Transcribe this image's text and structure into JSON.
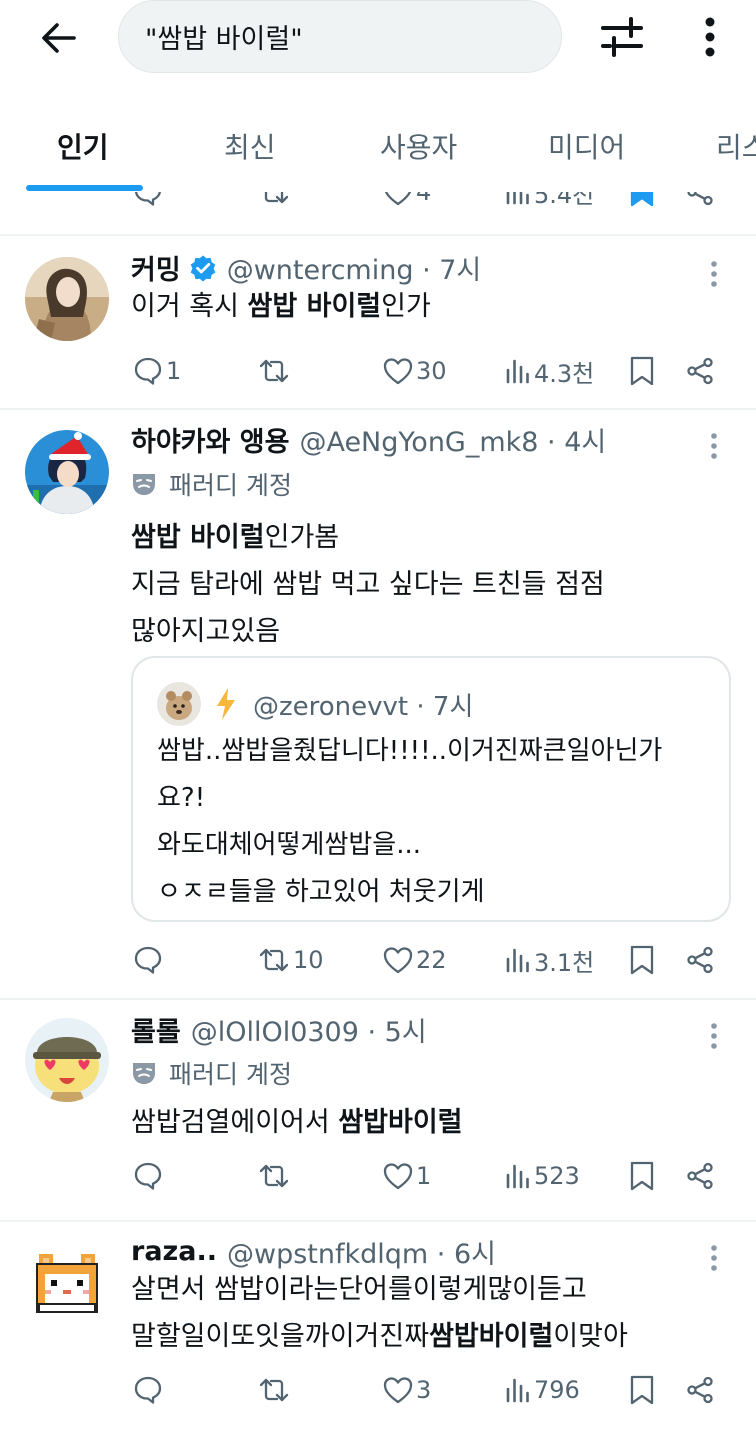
{
  "search": {
    "query": "\"쌈밥 바이럴\""
  },
  "tabs": [
    {
      "label": "인기",
      "active": true
    },
    {
      "label": "최신"
    },
    {
      "label": "사용자"
    },
    {
      "label": "미디어"
    },
    {
      "label": "리스"
    }
  ],
  "top_partial": {
    "likes": "4",
    "views": "5.4천",
    "bookmarked": true
  },
  "tweets": [
    {
      "name": "커밍",
      "verified": true,
      "handle": "@wntercming · 7시",
      "line1_bold": "쌈밥 바이럴",
      "line1_pre": "이거 혹시 ",
      "line1_post": "인가",
      "replies": "1",
      "retweets": "",
      "likes": "30",
      "views": "4.3천"
    },
    {
      "name": "하야카와 앵용",
      "handle": "@AeNgYonG_mk8 · 4시",
      "parody": "패러디 계정",
      "line1_bold": "쌈밥 바이럴",
      "line1_post": "인가봄",
      "line2": "지금 탐라에 쌈밥 먹고 싶다는 트친들 점점",
      "line3": "많아지고있음",
      "quote": {
        "handle": "@zeronevvt · 7시",
        "lines": [
          "쌈밥..쌈밥을줬답니다!!!!..이거진짜큰일아닌가",
          "요?!",
          "와도대체어떻게쌈밥을...",
          "ㅇㅈㄹ들을 하고있어 처웃기게"
        ]
      },
      "replies": "",
      "retweets": "10",
      "likes": "22",
      "views": "3.1천"
    },
    {
      "name": "롤롤",
      "handle": "@lOllOl0309 · 5시",
      "parody": "패러디 계정",
      "line1_pre": "쌈밥검열에이어서 ",
      "line1_bold": "쌈밥바이럴",
      "replies": "",
      "retweets": "",
      "likes": "1",
      "views": "523"
    },
    {
      "name": "raza..",
      "handle": "@wpstnfkdlqm · 6시",
      "line1": "살면서 쌈밥이라는단어를이렇게많이듣고",
      "line2_pre": "말할일이또잇을까이거진짜",
      "line2_bold": "쌈밥바이럴",
      "line2_post": "이맞아",
      "replies": "",
      "retweets": "",
      "likes": "3",
      "views": "796"
    }
  ],
  "colors": {
    "accent": "#1d9bf0",
    "secondary_text": "#536471",
    "divider": "#eff3f4"
  }
}
